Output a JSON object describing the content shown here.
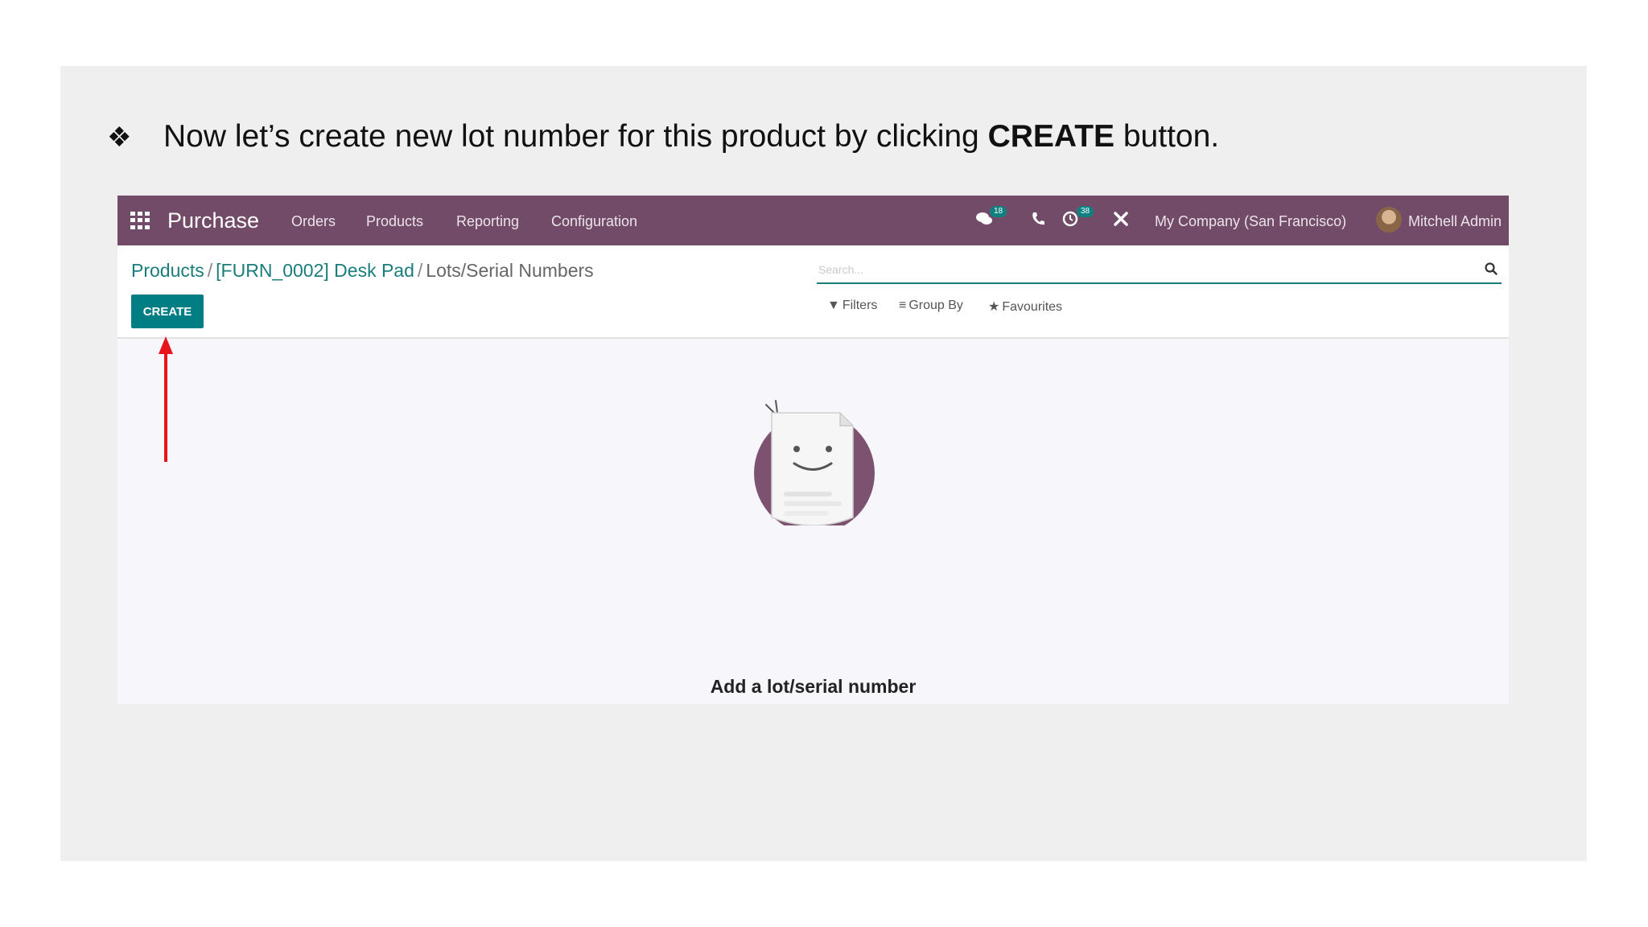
{
  "instruction": {
    "bullet": "❖",
    "before": "Now let’s create new lot number for this product by clicking ",
    "bold": "CREATE",
    "after": " button."
  },
  "navbar": {
    "brand": "Purchase",
    "menu": [
      "Orders",
      "Products",
      "Reporting",
      "Configuration"
    ],
    "messages_badge": "18",
    "activities_badge": "38",
    "company": "My Company (San Francisco)",
    "user": "Mitchell Admin"
  },
  "breadcrumb": {
    "item1": "Products",
    "separator": "/",
    "item2": "[FURN_0002] Desk Pad",
    "current": "Lots/Serial Numbers"
  },
  "create_button": "CREATE",
  "search": {
    "placeholder": "Search..."
  },
  "filters": {
    "filters": "Filters",
    "group_by": "Group By",
    "favourites": "Favourites"
  },
  "empty_state": {
    "title": "Add a lot/serial number"
  },
  "colors": {
    "navbar": "#714b67",
    "primary": "#017e84",
    "link": "#1a7d7c",
    "arrow": "#e8141c"
  }
}
